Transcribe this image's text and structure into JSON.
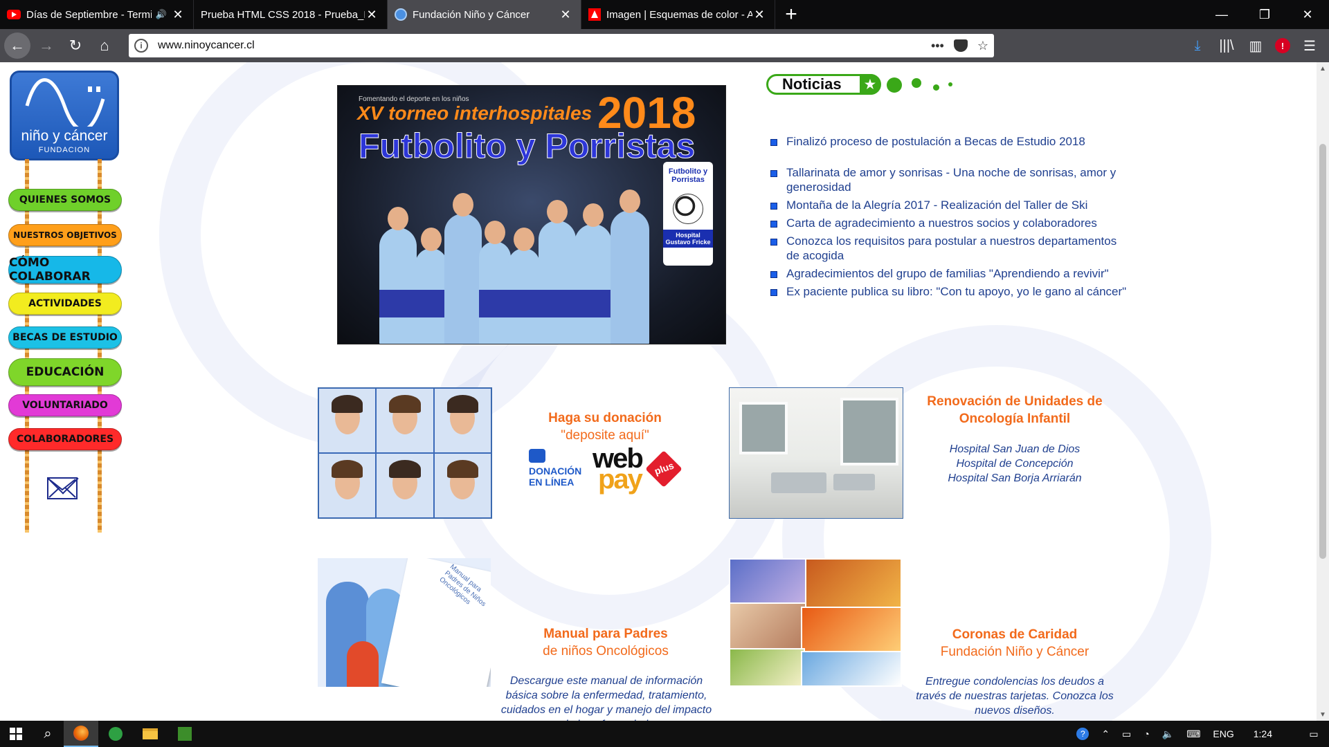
{
  "browser": {
    "tabs": [
      {
        "title": "Días de Septiembre - Termi",
        "icon": "youtube-icon",
        "active": false,
        "audio": true
      },
      {
        "title": "Prueba HTML CSS 2018 - Prueba_H",
        "icon": "none",
        "active": false,
        "audio": false
      },
      {
        "title": "Fundación Niño y Cáncer",
        "icon": "globe-icon",
        "active": true,
        "audio": false
      },
      {
        "title": "Imagen | Esquemas de color - A",
        "icon": "adobe-icon",
        "active": false,
        "audio": false
      }
    ],
    "new_tab_symbol": "+",
    "url": "www.ninoycancer.cl",
    "window_controls": {
      "minimize": "—",
      "maximize": "❐",
      "close": "✕"
    }
  },
  "sidebar": {
    "logo": {
      "text": "niño y cáncer",
      "subtitle": "FUNDACION"
    },
    "menu": [
      {
        "label": "QUIENES SOMOS",
        "color": "#6fd02a"
      },
      {
        "label": "NUESTROS OBJETIVOS",
        "color": "#ff9f1a"
      },
      {
        "label": "CÓMO COLABORAR",
        "color": "#16b8e8"
      },
      {
        "label": "ACTIVIDADES",
        "color": "#f2ec1f"
      },
      {
        "label": "BECAS DE ESTUDIO",
        "color": "#1cc1e6"
      },
      {
        "label": "EDUCACIÓN",
        "color": "#7fd62a"
      },
      {
        "label": "VOLUNTARIADO",
        "color": "#e23ad6"
      },
      {
        "label": "COLABORADORES",
        "color": "#ff2a2a"
      }
    ],
    "contact_icon": "envelope-icon"
  },
  "hero": {
    "kicker": "Fomentando el deporte en los niños",
    "torneo": "XV torneo interhospitales",
    "year": "2018",
    "title": "Futbolito y Porristas",
    "badge_title": "Futbolito y Porristas",
    "badge_hospital": "Hospital Gustavo Fricke"
  },
  "noticias": {
    "header": "Noticias",
    "items": [
      "Finalizó proceso de postulación a Becas de Estudio 2018",
      "Tallarinata de amor y sonrisas - Una noche de sonrisas, amor y generosidad",
      "Montaña de la Alegría 2017 - Realización del Taller de Ski",
      "Carta de agradecimiento a nuestros socios y colaboradores",
      "Conozca los requisitos para postular a nuestros departamentos de acogida",
      "Agradecimientos del grupo de familias \"Aprendiendo a revivir\"",
      "Ex paciente publica su libro: \"Con tu apoyo, yo le gano al cáncer\""
    ]
  },
  "blocks": {
    "donacion": {
      "title": "Haga su donación",
      "subtitle": "\"deposite aquí\"",
      "logo_line1": "DONACIÓN",
      "logo_line2": "EN LÍNEA",
      "webpay_web": "web",
      "webpay_pay": "pay",
      "webpay_plus": "plus"
    },
    "renovacion": {
      "title": "Renovación de Unidades de Oncología Infantil",
      "hospitals": [
        "Hospital San Juan de Dios",
        "Hospital de Concepción",
        "Hospital San Borja Arriarán"
      ]
    },
    "manual": {
      "title": "Manual para Padres",
      "subtitle": "de niños Oncológicos",
      "description": "Descargue este manual de información básica sobre la enfermedad, tratamiento, cuidados en el hogar y manejo del impacto de la enfermedad.",
      "book_title": "Manual para Padres de Niños Oncológicos"
    },
    "coronas": {
      "title": "Coronas de Caridad",
      "subtitle": "Fundación Niño y Cáncer",
      "description": "Entregue condolencias los deudos a través de nuestras tarjetas. Conozca los nuevos diseños."
    }
  },
  "taskbar": {
    "language": "ENG",
    "time": "1:24"
  }
}
